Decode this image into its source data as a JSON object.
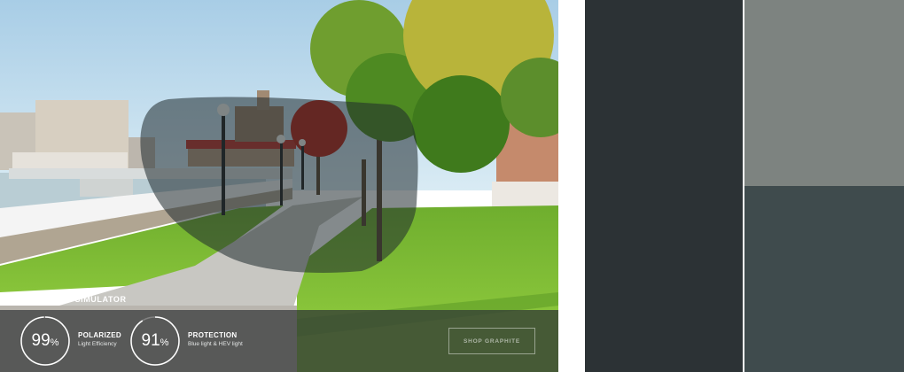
{
  "simulator": {
    "title": "REVO LENS SIMULATOR",
    "stats": [
      {
        "value": "99",
        "unit": "%",
        "percent": 99,
        "label": "POLARIZED",
        "sublabel": "Light Efficiency"
      },
      {
        "value": "91",
        "unit": "%",
        "percent": 91,
        "label": "PROTECTION",
        "sublabel": "Blue light & HEV light"
      }
    ],
    "shop_button": "SHOP GRAPHITE"
  },
  "swatches": {
    "colors": [
      "#2c3235",
      "#7d8380",
      "#3f4b4d"
    ]
  }
}
